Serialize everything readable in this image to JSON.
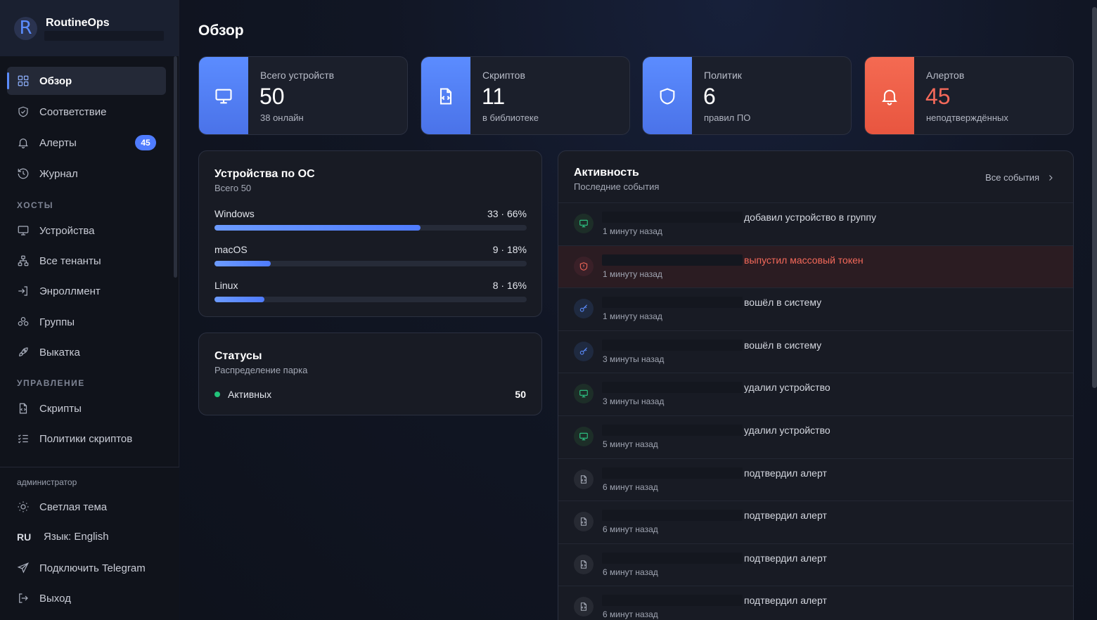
{
  "brand": {
    "name": "RoutineOps",
    "logo_letter": "R"
  },
  "sidebar": {
    "nav": [
      {
        "label": "Обзор",
        "icon": "dashboard-icon",
        "active": true
      },
      {
        "label": "Соответствие",
        "icon": "shield-check-icon"
      },
      {
        "label": "Алерты",
        "icon": "bell-icon",
        "badge": "45"
      },
      {
        "label": "Журнал",
        "icon": "history-icon"
      }
    ],
    "section_hosts": "ХОСТЫ",
    "hosts": [
      {
        "label": "Устройства",
        "icon": "monitor-icon"
      },
      {
        "label": "Все тенанты",
        "icon": "network-icon"
      },
      {
        "label": "Энроллмент",
        "icon": "login-icon"
      },
      {
        "label": "Группы",
        "icon": "group-icon"
      },
      {
        "label": "Выкатка",
        "icon": "rocket-icon"
      }
    ],
    "section_manage": "УПРАВЛЕНИЕ",
    "manage": [
      {
        "label": "Скрипты",
        "icon": "file-code-icon"
      },
      {
        "label": "Политики скриптов",
        "icon": "list-check-icon"
      }
    ],
    "bottom": {
      "role": "администратор",
      "theme": "Светлая тема",
      "lang_code": "RU",
      "lang": "Язык: English",
      "telegram": "Подключить Telegram",
      "logout": "Выход"
    }
  },
  "main": {
    "title": "Обзор"
  },
  "stats": [
    {
      "label": "Всего устройств",
      "value": "50",
      "sub": "38 онлайн",
      "icon": "monitor-icon"
    },
    {
      "label": "Скриптов",
      "value": "11",
      "sub": "в библиотеке",
      "icon": "file-code-icon"
    },
    {
      "label": "Политик",
      "value": "6",
      "sub": "правил ПО",
      "icon": "shield-icon"
    },
    {
      "label": "Алертов",
      "value": "45",
      "sub": "неподтверждённых",
      "icon": "bell-icon"
    }
  ],
  "os_panel": {
    "title": "Устройства по ОС",
    "sub": "Всего 50",
    "rows": [
      {
        "name": "Windows",
        "count": "33 · 66%",
        "fraction": 0.66
      },
      {
        "name": "macOS",
        "count": "9 · 18%",
        "fraction": 0.18
      },
      {
        "name": "Linux",
        "count": "8 · 16%",
        "fraction": 0.16
      }
    ]
  },
  "status_panel": {
    "title": "Статусы",
    "sub": "Распределение парка",
    "rows": [
      {
        "label": "Активных",
        "count": "50",
        "color": "#22c37a"
      }
    ]
  },
  "activity": {
    "title": "Активность",
    "sub": "Последние события",
    "link": "Все события",
    "events": [
      {
        "text": "добавил устройство в группу",
        "time": "1 минуту назад",
        "icon": "monitor-icon",
        "tone": "green"
      },
      {
        "text": "выпустил массовый токен",
        "time": "1 минуту назад",
        "icon": "shield-alert-icon",
        "tone": "red"
      },
      {
        "text": "вошёл в систему",
        "time": "1 минуту назад",
        "icon": "key-icon",
        "tone": "blue"
      },
      {
        "text": "вошёл в систему",
        "time": "3 минуты назад",
        "icon": "key-icon",
        "tone": "blue"
      },
      {
        "text": "удалил устройство",
        "time": "3 минуты назад",
        "icon": "monitor-icon",
        "tone": "green"
      },
      {
        "text": "удалил устройство",
        "time": "5 минут назад",
        "icon": "monitor-icon",
        "tone": "green"
      },
      {
        "text": "подтвердил алерт",
        "time": "6 минут назад",
        "icon": "file-code-icon",
        "tone": "gray"
      },
      {
        "text": "подтвердил алерт",
        "time": "6 минут назад",
        "icon": "file-code-icon",
        "tone": "gray"
      },
      {
        "text": "подтвердил алерт",
        "time": "6 минут назад",
        "icon": "file-code-icon",
        "tone": "gray"
      },
      {
        "text": "подтвердил алерт",
        "time": "6 минут назад",
        "icon": "file-code-icon",
        "tone": "gray"
      }
    ]
  }
}
